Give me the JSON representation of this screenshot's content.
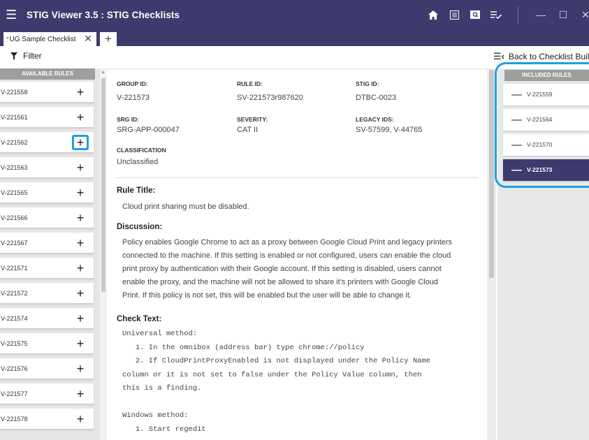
{
  "window": {
    "title": "STIG Viewer 3.5 : STIG Checklists",
    "icons": [
      "home-icon",
      "list-view-icon",
      "image-search-icon",
      "checklist-icon"
    ],
    "controls": [
      "minimize-icon",
      "maximize-icon",
      "close-icon"
    ]
  },
  "tabs": [
    {
      "label": "UG Sample Checklist",
      "modified_marker": "*",
      "close": "✕"
    }
  ],
  "tab_add_label": "+",
  "toolbar": {
    "filter_label": "Filter",
    "back_label": "Back to Checklist Builder"
  },
  "available_rules": {
    "header": "AVAILABLE RULES",
    "add_symbol": "+",
    "items": [
      "V-221558",
      "V-221561",
      "V-221562",
      "V-221563",
      "V-221565",
      "V-221566",
      "V-221567",
      "V-221571",
      "V-221572",
      "V-221574",
      "V-221575",
      "V-221576",
      "V-221577",
      "V-221578"
    ],
    "highlighted_index": 2
  },
  "rule_detail": {
    "group_id_label": "GROUP ID:",
    "group_id": "V-221573",
    "rule_id_label": "RULE ID:",
    "rule_id": "SV-221573r987620",
    "stig_id_label": "STIG ID:",
    "stig_id": "DTBC-0023",
    "srg_id_label": "SRG ID:",
    "srg_id": "SRG-APP-000047",
    "severity_label": "SEVERITY:",
    "severity": "CAT II",
    "legacy_ids_label": "LEGACY IDS:",
    "legacy_ids": "SV-57599, V-44765",
    "classification_label": "CLASSIFICATION",
    "classification": "Unclassified",
    "rule_title_heading": "Rule Title:",
    "rule_title": "Cloud print sharing must be disabled.",
    "discussion_heading": "Discussion:",
    "discussion_lines": [
      "Policy enables Google Chrome to act as a proxy between Google Cloud Print and legacy printers",
      "connected to the machine. If this setting is enabled or not configured, users can enable the cloud",
      "print proxy by authentication with their Google account. If this setting is disabled, users cannot",
      "enable the proxy, and the machine will not be allowed to share it's printers with Google Cloud",
      "Print. If this policy is not set, this will be enabled but the user will be able to change it."
    ],
    "check_text_heading": "Check Text:",
    "check_text_lines": [
      "Universal method:",
      "   1. In the omnibox (address bar) type chrome://policy",
      "   2. If CloudPrintProxyEnabled is not displayed under the Policy Name",
      "column or it is not set to false under the Policy Value column, then",
      "this is a finding.",
      "",
      "Windows method:",
      "   1. Start regedit"
    ]
  },
  "included_rules": {
    "header": "INCLUDED RULES",
    "remove_symbol": "—",
    "items": [
      "V-221559",
      "V-221564",
      "V-221570",
      "V-221573"
    ],
    "selected_index": 3
  },
  "colors": {
    "title_bar": "#3d3b6e",
    "highlight": "#1ea0e0",
    "selected_row": "#3d3b6e",
    "column_header": "#9e9e9e"
  }
}
